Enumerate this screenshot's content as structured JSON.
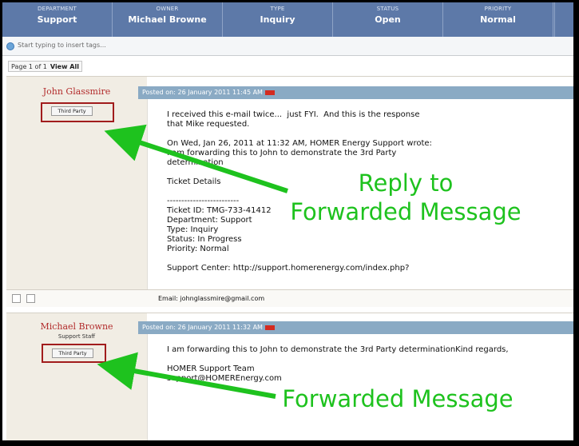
{
  "header": {
    "columns": [
      {
        "label": "DEPARTMENT",
        "value": "Support"
      },
      {
        "label": "OWNER",
        "value": "Michael Browne"
      },
      {
        "label": "TYPE",
        "value": "Inquiry"
      },
      {
        "label": "STATUS",
        "value": "Open"
      },
      {
        "label": "PRIORITY",
        "value": "Normal"
      }
    ]
  },
  "tags": {
    "placeholder": "Start typing to insert tags..."
  },
  "pager": {
    "page": "Page 1 of 1",
    "view_all": "View All"
  },
  "posts": [
    {
      "author": "John Glassmire",
      "role": "",
      "badge": "Third Party",
      "posted": "Posted on: 26 January 2011 11:45 AM",
      "message": "I received this e-mail twice...  just FYI.  And this is the response\nthat Mike requested.\n\nOn Wed, Jan 26, 2011 at 11:32 AM, HOMER Energy Support wrote:\nI am forwarding this to John to demonstrate the 3rd Party\ndetermination\n\nTicket Details\n\n-------------------------\nTicket ID: TMG-733-41412\nDepartment: Support\nType: Inquiry\nStatus: In Progress\nPriority: Normal\n\nSupport Center: http://support.homerenergy.com/index.php?",
      "email": "Email: johnglassmire@gmail.com"
    },
    {
      "author": "Michael Browne",
      "role": "Support Staff",
      "badge": "Third Party",
      "posted": "Posted on: 26 January 2011 11:32 AM",
      "message": "I am forwarding this to John to demonstrate the 3rd Party determinationKind regards,\n\nHOMER Support Team\nsupport@HOMEREnergy.com"
    }
  ],
  "annotations": {
    "reply": "Reply to\nForwarded Message",
    "forwarded": "Forwarded Message"
  }
}
